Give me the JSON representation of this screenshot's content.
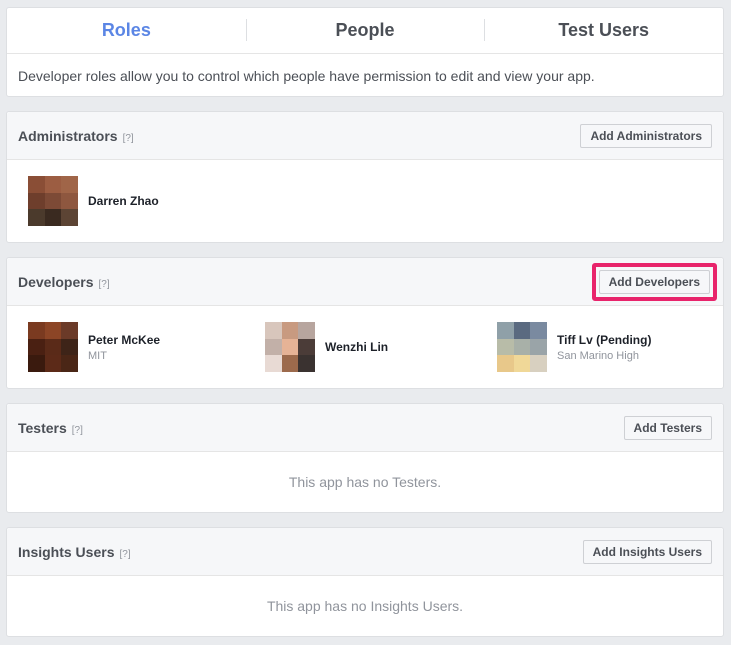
{
  "tabs": [
    {
      "label": "Roles",
      "active": true
    },
    {
      "label": "People",
      "active": false
    },
    {
      "label": "Test Users",
      "active": false
    }
  ],
  "description": "Developer roles allow you to control which people have permission to edit and view your app.",
  "help_label": "[?]",
  "administrators": {
    "title": "Administrators",
    "button": "Add Administrators",
    "people": [
      {
        "name": "Darren Zhao",
        "sub": "",
        "avatar": [
          "#8a4e36",
          "#9c5d42",
          "#a06548",
          "#6e3e2c",
          "#7d4a36",
          "#8e573f",
          "#4b3a2c",
          "#3a2a20",
          "#5c4434"
        ]
      }
    ]
  },
  "developers": {
    "title": "Developers",
    "button": "Add Developers",
    "people": [
      {
        "name": "Peter McKee",
        "sub": "MIT",
        "avatar": [
          "#7a3a20",
          "#8c4526",
          "#6b3a28",
          "#4a2012",
          "#5a2a18",
          "#3e2418",
          "#3a1a0e",
          "#5c2a18",
          "#4a2616"
        ]
      },
      {
        "name": "Wenzhi Lin",
        "sub": "",
        "avatar": [
          "#d8c6bc",
          "#c89a80",
          "#b7a59e",
          "#c2b0a8",
          "#e6b396",
          "#4b3c38",
          "#e8dad4",
          "#9c6a4c",
          "#3a3230"
        ]
      },
      {
        "name": "Tiff Lv (Pending)",
        "sub": "San Marino High",
        "avatar": [
          "#8fa0a8",
          "#5a6a80",
          "#7a8aa0",
          "#b8bca8",
          "#a8b0a8",
          "#9aa4a8",
          "#e8c88a",
          "#f0d898",
          "#d8d0c0"
        ]
      }
    ]
  },
  "testers": {
    "title": "Testers",
    "button": "Add Testers",
    "empty": "This app has no Testers."
  },
  "insights": {
    "title": "Insights Users",
    "button": "Add Insights Users",
    "empty": "This app has no Insights Users."
  },
  "colors": {
    "accent": "#5b86e5",
    "highlight": "#e8246b"
  }
}
